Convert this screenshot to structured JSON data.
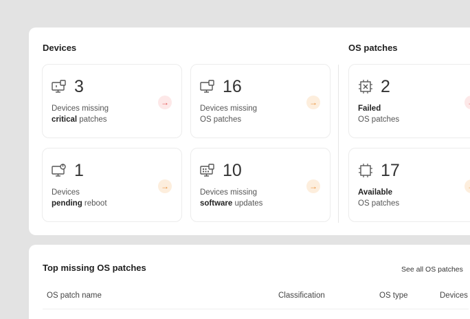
{
  "devices": {
    "title": "Devices",
    "cards": [
      {
        "count": "3",
        "line1": "Devices missing",
        "bold": "critical",
        "rest": " patches",
        "arrow": "→",
        "icon": "monitor-alert-icon"
      },
      {
        "count": "16",
        "line1": "Devices missing",
        "bold": "",
        "rest": "OS patches",
        "arrow": "→",
        "icon": "monitor-patch-icon"
      },
      {
        "count": "1",
        "line1": "Devices",
        "bold": "pending",
        "rest": " reboot",
        "arrow": "→",
        "icon": "monitor-reboot-icon"
      },
      {
        "count": "10",
        "line1": "Devices missing",
        "bold": "software",
        "rest": " updates",
        "arrow": "→",
        "icon": "monitor-software-icon"
      }
    ]
  },
  "os_patches": {
    "title": "OS patches",
    "cards": [
      {
        "count": "2",
        "bold": "Failed",
        "line2": "OS patches",
        "arrow": "→",
        "icon": "chip-failed-icon"
      },
      {
        "count": "17",
        "bold": "Available",
        "line2": "OS patches",
        "arrow": "→",
        "icon": "chip-available-icon"
      }
    ]
  },
  "top_missing": {
    "title": "Top missing OS patches",
    "see_all": "See all OS patches",
    "chevron": ">",
    "columns": [
      "OS patch name",
      "Classification",
      "OS type",
      "Devices"
    ]
  },
  "colors": {
    "red_accent": "#e24a4a",
    "orange_accent": "#e88a2e"
  }
}
